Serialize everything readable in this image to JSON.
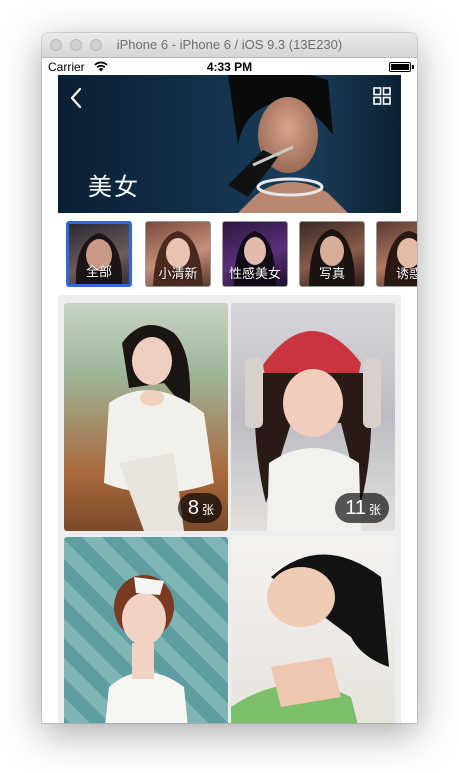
{
  "simulator": {
    "title": "iPhone 6 - iPhone 6 / iOS 9.3 (13E230)"
  },
  "status_bar": {
    "carrier": "Carrier",
    "time": "4:33 PM"
  },
  "banner": {
    "title": "美女",
    "back_icon": "chevron-left-icon",
    "grid_icon": "grid-icon"
  },
  "categories": [
    {
      "label": "全部",
      "selected": true
    },
    {
      "label": "小清新",
      "selected": false
    },
    {
      "label": "性感美女",
      "selected": false
    },
    {
      "label": "写真",
      "selected": false
    },
    {
      "label": "诱惑",
      "selected": false
    }
  ],
  "gallery": [
    {
      "count": "8",
      "unit": "张"
    },
    {
      "count": "11",
      "unit": "张"
    },
    {
      "count": "",
      "unit": ""
    },
    {
      "count": "",
      "unit": ""
    }
  ],
  "colors": {
    "selected_border": "#2f6bd8",
    "banner_bg": "#12314c"
  }
}
